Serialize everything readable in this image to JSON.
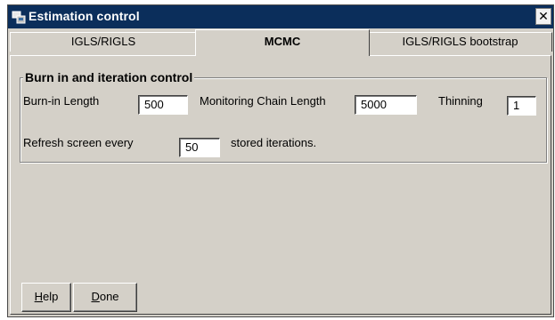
{
  "window": {
    "title": "Estimation control",
    "close_glyph": "✕"
  },
  "tabs": [
    {
      "label": "IGLS/RIGLS",
      "active": false
    },
    {
      "label": "MCMC",
      "active": true
    },
    {
      "label": "IGLS/RIGLS bootstrap",
      "active": false
    }
  ],
  "group": {
    "title": "Burn in and iteration control",
    "burn_in_label": "Burn-in Length",
    "burn_in_value": "500",
    "chain_label": "Monitoring Chain Length",
    "chain_value": "5000",
    "thinning_label": "Thinning",
    "thinning_value": "1",
    "refresh_label": "Refresh screen every",
    "refresh_value": "50",
    "refresh_suffix": "stored iterations."
  },
  "buttons": {
    "help_mnemonic": "H",
    "help_rest": "elp",
    "done_mnemonic": "D",
    "done_rest": "one"
  }
}
